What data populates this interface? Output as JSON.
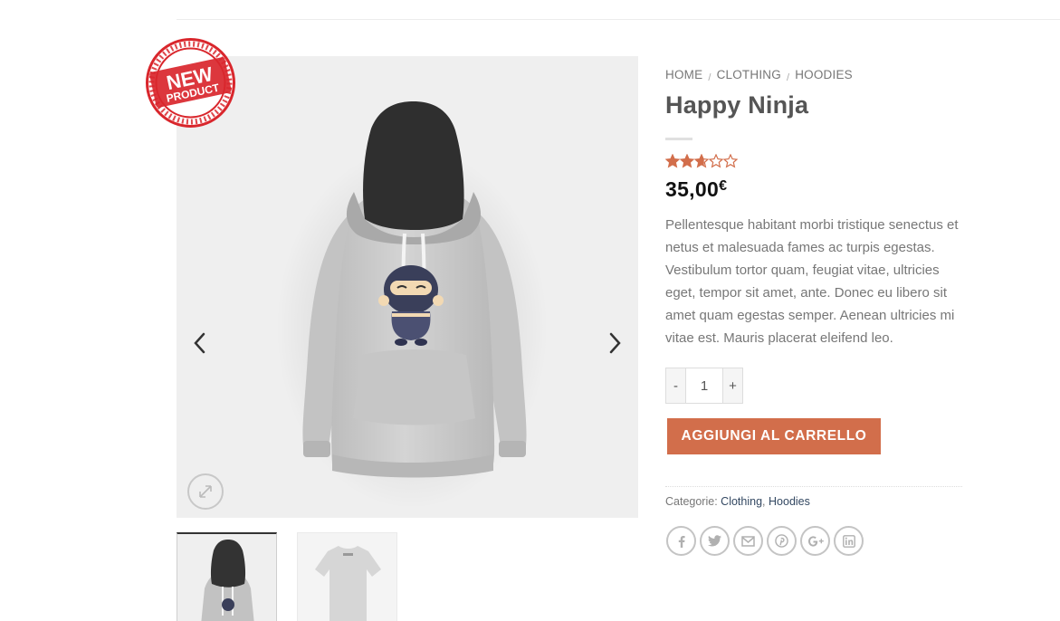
{
  "breadcrumb": {
    "home": "HOME",
    "clothing": "CLOTHING",
    "hoodies": "HOODIES",
    "separator": "/"
  },
  "product": {
    "title": "Happy Ninja",
    "rating": 2.67,
    "rating_max": 5,
    "price_amount": "35,00",
    "price_currency": "€",
    "description": "Pellentesque habitant morbi tristique senectus et netus et malesuada fames ac turpis egestas. Vestibulum tortor quam, feugiat vitae, ultricies eget, tempor sit amet, ante. Donec eu libero sit amet quam egestas semper. Aenean ultricies mi vitae est. Mauris placerat eleifend leo.",
    "quantity": "1",
    "qty_minus": "-",
    "qty_plus": "+",
    "add_to_cart": "AGGIUNGI AL CARRELLO"
  },
  "meta": {
    "categories_label": "Categorie:",
    "category_1": "Clothing",
    "category_sep": ",",
    "category_2": "Hoodies"
  },
  "badge": {
    "text_line1": "NEW",
    "text_line2": "PRODUCT",
    "ring_text": "NEW PRODUCT"
  },
  "share": [
    "facebook-icon",
    "twitter-icon",
    "email-icon",
    "pinterest-icon",
    "google-plus-icon",
    "linkedin-icon"
  ],
  "colors": {
    "accent": "#d26e4b",
    "link": "#334862",
    "badge_red": "#d9262c",
    "star": "#d26e4b"
  }
}
